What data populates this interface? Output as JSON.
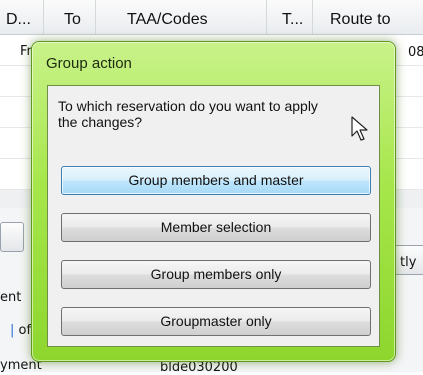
{
  "grid": {
    "columns": [
      "D...",
      "To",
      "TAA/Codes",
      "T...",
      "Route to"
    ],
    "row1": {
      "col1": "Fr",
      "route_fragment": "08"
    }
  },
  "background": {
    "side_label_1": "ent",
    "side_label_2": "of",
    "side_label_3": "yment",
    "bottom_code": "blde030200",
    "right_fragment": "tly"
  },
  "dialog": {
    "title": "Group action",
    "question": "To which reservation do you want to apply the changes?",
    "buttons": [
      "Group members and master",
      "Member selection",
      "Group members only",
      "Groupmaster only"
    ]
  }
}
